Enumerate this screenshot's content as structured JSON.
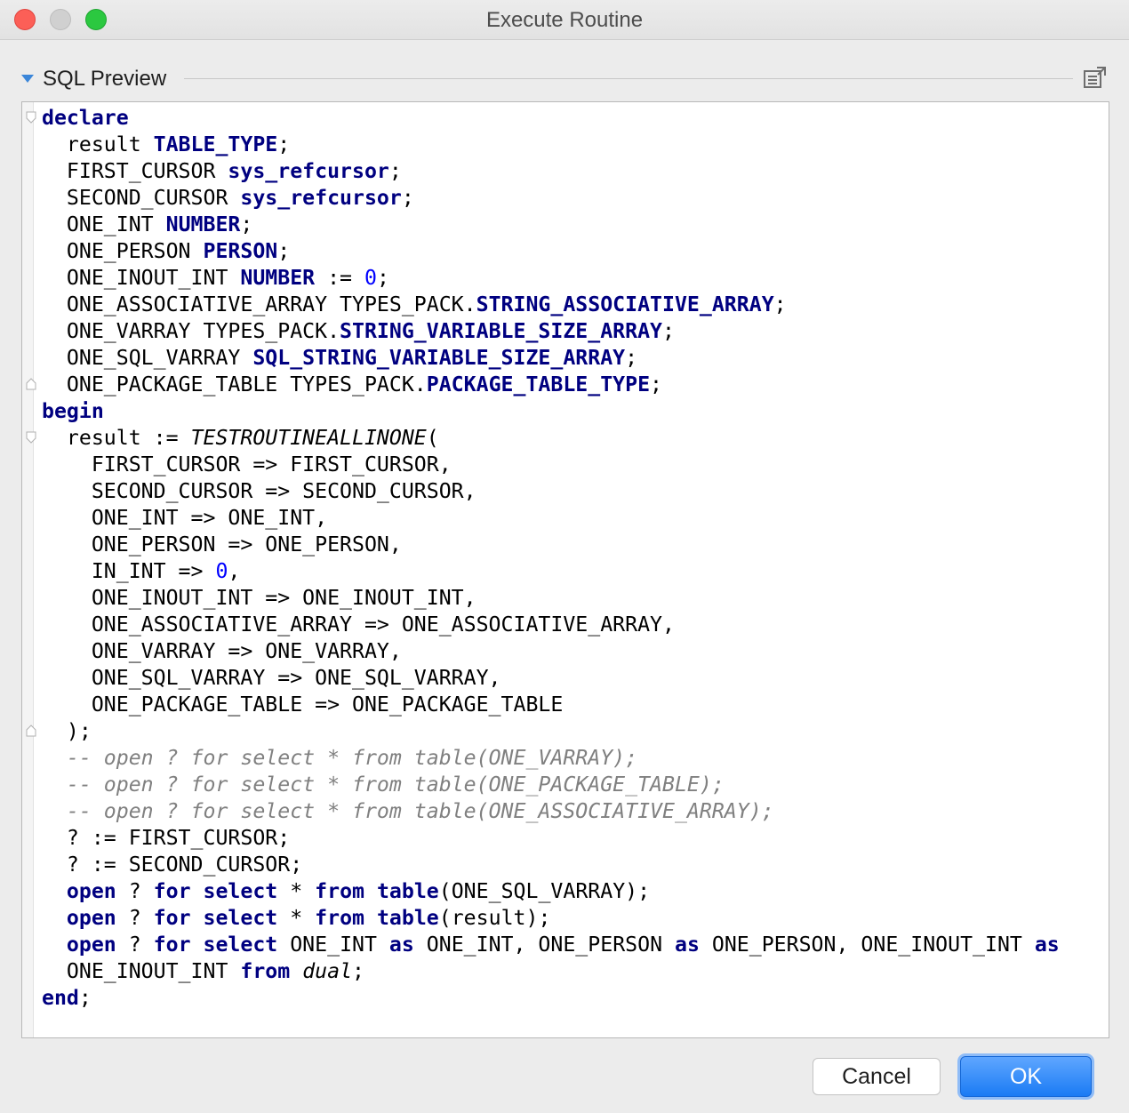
{
  "window": {
    "title": "Execute Routine"
  },
  "section": {
    "title": "SQL Preview",
    "toggle_icon": "triangle-down-icon",
    "popout_icon": "popout-window-icon"
  },
  "code_lines": [
    [
      [
        "kw",
        "declare"
      ]
    ],
    [
      [
        "t",
        "  result "
      ],
      [
        "kw",
        "TABLE_TYPE"
      ],
      [
        "t",
        ";"
      ]
    ],
    [
      [
        "t",
        "  FIRST_CURSOR "
      ],
      [
        "kw",
        "sys_refcursor"
      ],
      [
        "t",
        ";"
      ]
    ],
    [
      [
        "t",
        "  SECOND_CURSOR "
      ],
      [
        "kw",
        "sys_refcursor"
      ],
      [
        "t",
        ";"
      ]
    ],
    [
      [
        "t",
        "  ONE_INT "
      ],
      [
        "kw",
        "NUMBER"
      ],
      [
        "t",
        ";"
      ]
    ],
    [
      [
        "t",
        "  ONE_PERSON "
      ],
      [
        "kw",
        "PERSON"
      ],
      [
        "t",
        ";"
      ]
    ],
    [
      [
        "t",
        "  ONE_INOUT_INT "
      ],
      [
        "kw",
        "NUMBER"
      ],
      [
        "t",
        " := "
      ],
      [
        "num",
        "0"
      ],
      [
        "t",
        ";"
      ]
    ],
    [
      [
        "t",
        "  ONE_ASSOCIATIVE_ARRAY TYPES_PACK."
      ],
      [
        "kw",
        "STRING_ASSOCIATIVE_ARRAY"
      ],
      [
        "t",
        ";"
      ]
    ],
    [
      [
        "t",
        "  ONE_VARRAY TYPES_PACK."
      ],
      [
        "kw",
        "STRING_VARIABLE_SIZE_ARRAY"
      ],
      [
        "t",
        ";"
      ]
    ],
    [
      [
        "t",
        "  ONE_SQL_VARRAY "
      ],
      [
        "kw",
        "SQL_STRING_VARIABLE_SIZE_ARRAY"
      ],
      [
        "t",
        ";"
      ]
    ],
    [
      [
        "t",
        "  ONE_PACKAGE_TABLE TYPES_PACK."
      ],
      [
        "kw",
        "PACKAGE_TABLE_TYPE"
      ],
      [
        "t",
        ";"
      ]
    ],
    [
      [
        "kw",
        "begin"
      ]
    ],
    [
      [
        "t",
        "  result := "
      ],
      [
        "it",
        "TESTROUTINEALLINONE"
      ],
      [
        "t",
        "("
      ]
    ],
    [
      [
        "t",
        "    FIRST_CURSOR => FIRST_CURSOR,"
      ]
    ],
    [
      [
        "t",
        "    SECOND_CURSOR => SECOND_CURSOR,"
      ]
    ],
    [
      [
        "t",
        "    ONE_INT => ONE_INT,"
      ]
    ],
    [
      [
        "t",
        "    ONE_PERSON => ONE_PERSON,"
      ]
    ],
    [
      [
        "t",
        "    IN_INT => "
      ],
      [
        "num",
        "0"
      ],
      [
        "t",
        ","
      ]
    ],
    [
      [
        "t",
        "    ONE_INOUT_INT => ONE_INOUT_INT,"
      ]
    ],
    [
      [
        "t",
        "    ONE_ASSOCIATIVE_ARRAY => ONE_ASSOCIATIVE_ARRAY,"
      ]
    ],
    [
      [
        "t",
        "    ONE_VARRAY => ONE_VARRAY,"
      ]
    ],
    [
      [
        "t",
        "    ONE_SQL_VARRAY => ONE_SQL_VARRAY,"
      ]
    ],
    [
      [
        "t",
        "    ONE_PACKAGE_TABLE => ONE_PACKAGE_TABLE"
      ]
    ],
    [
      [
        "t",
        "  );"
      ]
    ],
    [
      [
        "t",
        "  "
      ],
      [
        "com",
        "-- open ? for select * from table(ONE_VARRAY);"
      ]
    ],
    [
      [
        "t",
        "  "
      ],
      [
        "com",
        "-- open ? for select * from table(ONE_PACKAGE_TABLE);"
      ]
    ],
    [
      [
        "t",
        "  "
      ],
      [
        "com",
        "-- open ? for select * from table(ONE_ASSOCIATIVE_ARRAY);"
      ]
    ],
    [
      [
        "t",
        "  ? := FIRST_CURSOR;"
      ]
    ],
    [
      [
        "t",
        "  ? := SECOND_CURSOR;"
      ]
    ],
    [
      [
        "t",
        "  "
      ],
      [
        "kw",
        "open"
      ],
      [
        "t",
        " ? "
      ],
      [
        "kw",
        "for select"
      ],
      [
        "t",
        " * "
      ],
      [
        "kw",
        "from table"
      ],
      [
        "t",
        "(ONE_SQL_VARRAY);"
      ]
    ],
    [
      [
        "t",
        "  "
      ],
      [
        "kw",
        "open"
      ],
      [
        "t",
        " ? "
      ],
      [
        "kw",
        "for select"
      ],
      [
        "t",
        " * "
      ],
      [
        "kw",
        "from table"
      ],
      [
        "t",
        "(result);"
      ]
    ],
    [
      [
        "t",
        "  "
      ],
      [
        "kw",
        "open"
      ],
      [
        "t",
        " ? "
      ],
      [
        "kw",
        "for select"
      ],
      [
        "t",
        " ONE_INT "
      ],
      [
        "kw",
        "as"
      ],
      [
        "t",
        " ONE_INT, ONE_PERSON "
      ],
      [
        "kw",
        "as"
      ],
      [
        "t",
        " ONE_PERSON, ONE_INOUT_INT "
      ],
      [
        "kw",
        "as"
      ]
    ],
    [
      [
        "t",
        "  ONE_INOUT_INT "
      ],
      [
        "kw",
        "from"
      ],
      [
        "t",
        " "
      ],
      [
        "it",
        "dual"
      ],
      [
        "t",
        ";"
      ]
    ],
    [
      [
        "kw",
        "end"
      ],
      [
        "t",
        ";"
      ]
    ]
  ],
  "buttons": {
    "cancel": "Cancel",
    "ok": "OK"
  },
  "colors": {
    "keyword": "#000080",
    "number": "#0000ff",
    "comment": "#808080",
    "accent": "#1a7bf4"
  }
}
